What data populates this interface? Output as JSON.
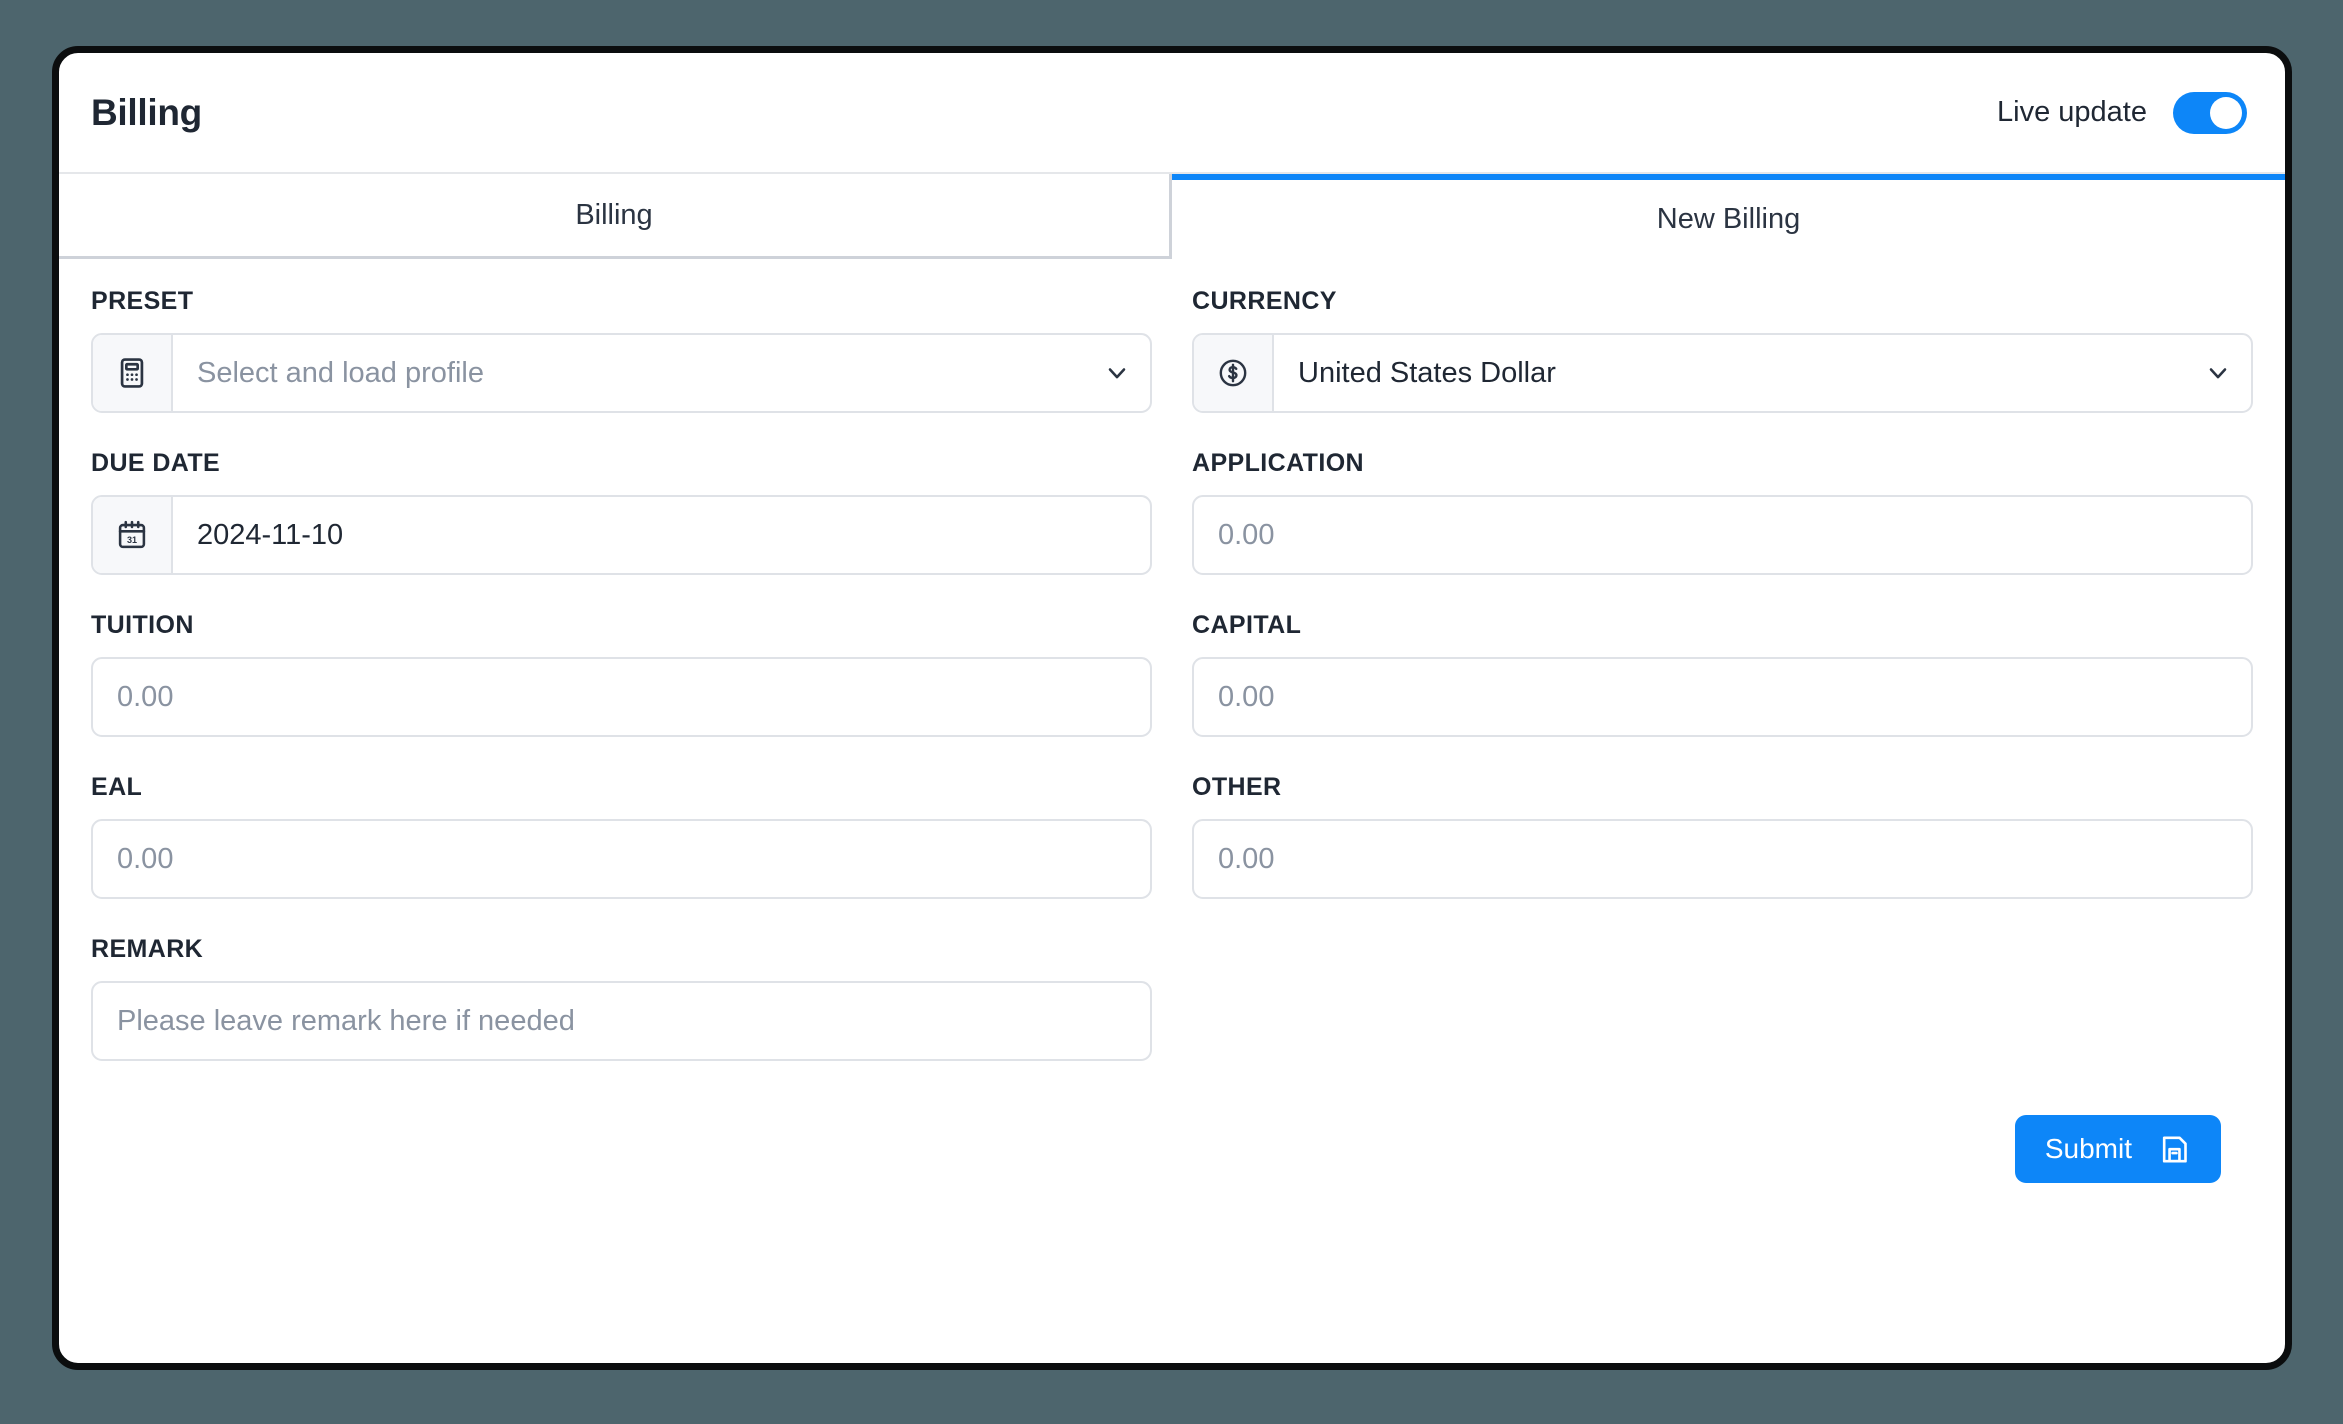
{
  "header": {
    "title": "Billing",
    "live_update_label": "Live update",
    "live_update_on": true
  },
  "tabs": [
    {
      "label": "Billing",
      "active": false
    },
    {
      "label": "New Billing",
      "active": true
    }
  ],
  "fields": {
    "preset": {
      "label": "PRESET",
      "value": "Select and load profile",
      "is_placeholder": true,
      "icon": "calculator-icon",
      "has_caret": true
    },
    "currency": {
      "label": "CURRENCY",
      "value": "United States Dollar",
      "is_placeholder": false,
      "icon": "dollar-circle-icon",
      "has_caret": true
    },
    "due_date": {
      "label": "DUE DATE",
      "value": "2024-11-10",
      "is_placeholder": false,
      "icon": "calendar-icon",
      "has_caret": false
    },
    "application": {
      "label": "APPLICATION",
      "value": "0.00",
      "is_placeholder": true,
      "icon": null,
      "has_caret": false
    },
    "tuition": {
      "label": "TUITION",
      "value": "0.00",
      "is_placeholder": true,
      "icon": null,
      "has_caret": false
    },
    "capital": {
      "label": "CAPITAL",
      "value": "0.00",
      "is_placeholder": true,
      "icon": null,
      "has_caret": false
    },
    "eal": {
      "label": "EAL",
      "value": "0.00",
      "is_placeholder": true,
      "icon": null,
      "has_caret": false
    },
    "other": {
      "label": "OTHER",
      "value": "0.00",
      "is_placeholder": true,
      "icon": null,
      "has_caret": false
    },
    "remark": {
      "label": "REMARK",
      "value": "Please leave remark here if needed",
      "is_placeholder": true,
      "icon": null,
      "has_caret": false
    }
  },
  "footer": {
    "submit_label": "Submit",
    "submit_icon": "save-icon"
  },
  "colors": {
    "accent": "#0d86f8",
    "page_background": "#4d656d",
    "card_border": "#0b0d0e",
    "text": "#1f2733",
    "placeholder": "#8a93a1",
    "field_border": "#dfe2e7",
    "addon_background": "#f7f8fa"
  }
}
